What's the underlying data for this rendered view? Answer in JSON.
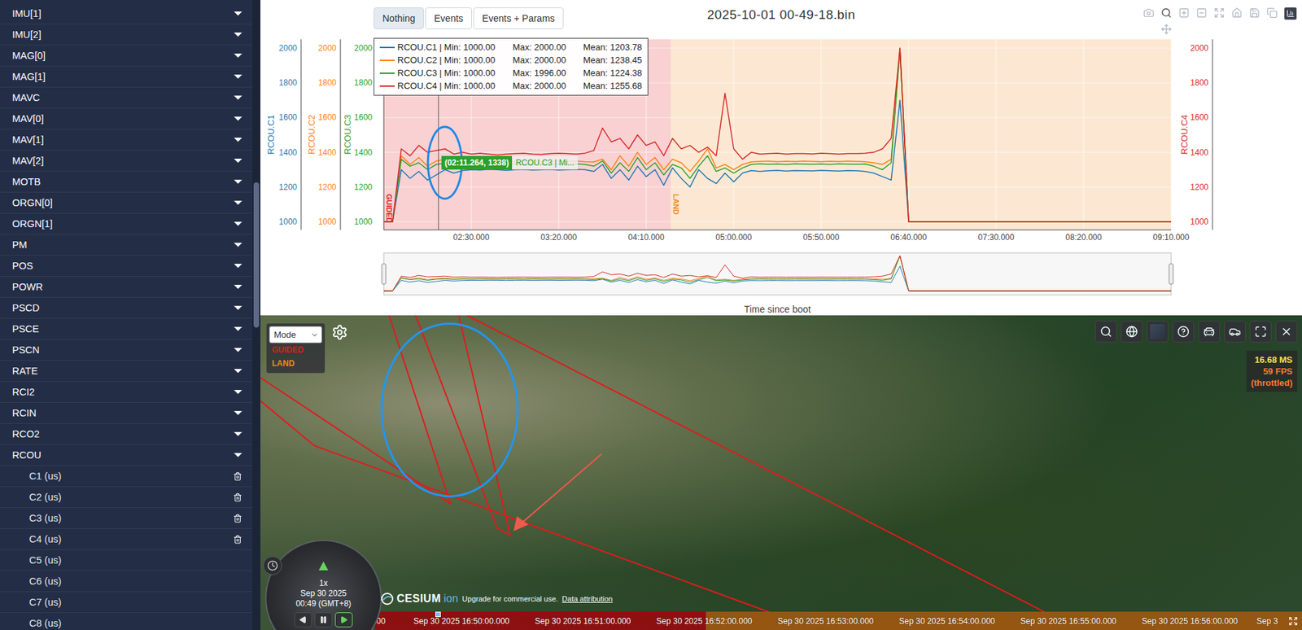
{
  "sidebar": {
    "scroll_position": 0.29,
    "scroll_size": 0.23,
    "items": [
      {
        "label": "IMU[1]",
        "expanded": false
      },
      {
        "label": "IMU[2]",
        "expanded": false
      },
      {
        "label": "MAG[0]",
        "expanded": false
      },
      {
        "label": "MAG[1]",
        "expanded": false
      },
      {
        "label": "MAVC",
        "expanded": false
      },
      {
        "label": "MAV[0]",
        "expanded": false
      },
      {
        "label": "MAV[1]",
        "expanded": false
      },
      {
        "label": "MAV[2]",
        "expanded": false
      },
      {
        "label": "MOTB",
        "expanded": false
      },
      {
        "label": "ORGN[0]",
        "expanded": false
      },
      {
        "label": "ORGN[1]",
        "expanded": false
      },
      {
        "label": "PM",
        "expanded": false
      },
      {
        "label": "POS",
        "expanded": false
      },
      {
        "label": "POWR",
        "expanded": false
      },
      {
        "label": "PSCD",
        "expanded": false
      },
      {
        "label": "PSCE",
        "expanded": false
      },
      {
        "label": "PSCN",
        "expanded": false
      },
      {
        "label": "RATE",
        "expanded": false
      },
      {
        "label": "RCI2",
        "expanded": false
      },
      {
        "label": "RCIN",
        "expanded": false
      },
      {
        "label": "RCO2",
        "expanded": false
      },
      {
        "label": "RCOU",
        "expanded": true,
        "children": [
          {
            "label": "C1 (us)",
            "plotted": true
          },
          {
            "label": "C2 (us)",
            "plotted": true
          },
          {
            "label": "C3 (us)",
            "plotted": true
          },
          {
            "label": "C4 (us)",
            "plotted": true
          },
          {
            "label": "C5 (us)",
            "plotted": false
          },
          {
            "label": "C6 (us)",
            "plotted": false
          },
          {
            "label": "C7 (us)",
            "plotted": false
          },
          {
            "label": "C8 (us)",
            "plotted": false
          }
        ]
      }
    ]
  },
  "plot": {
    "filter_buttons": [
      {
        "label": "Nothing",
        "selected": true
      },
      {
        "label": "Events",
        "selected": false
      },
      {
        "label": "Events + Params",
        "selected": false
      }
    ],
    "title": "2025-10-01 00-49-18.bin",
    "modebar": [
      {
        "kind": "camera",
        "selected": false
      },
      {
        "kind": "zoom",
        "selected": true
      },
      {
        "kind": "zoom-in",
        "selected": false
      },
      {
        "kind": "zoom-out",
        "selected": false
      },
      {
        "kind": "autoscale",
        "selected": false
      },
      {
        "kind": "home",
        "selected": false
      },
      {
        "kind": "save",
        "selected": false
      },
      {
        "kind": "copy",
        "selected": false
      },
      {
        "kind": "logo",
        "selected": false
      },
      {
        "kind": "pan",
        "selected": false
      }
    ],
    "x_axis": {
      "title": "Time since boot",
      "min_s": 100,
      "max_s": 550,
      "ticks": [
        {
          "label": "02:30.000",
          "t_s": 150
        },
        {
          "label": "03:20.000",
          "t_s": 200
        },
        {
          "label": "04:10.000",
          "t_s": 250
        },
        {
          "label": "05:00.000",
          "t_s": 300
        },
        {
          "label": "05:50.000",
          "t_s": 350
        },
        {
          "label": "06:40.000",
          "t_s": 400
        },
        {
          "label": "07:30.000",
          "t_s": 450
        },
        {
          "label": "08:20.000",
          "t_s": 500
        },
        {
          "label": "09:10.000",
          "t_s": 550
        }
      ]
    },
    "y_ticks": [
      "1000",
      "1200",
      "1400",
      "1600",
      "1800",
      "2000"
    ],
    "sample_start_s": 100,
    "sample_step_s": 5,
    "series": [
      {
        "name": "RCOU.C1",
        "color": "#1f77b4",
        "side": "left",
        "legend": "RCOU.C1 | Min: 1000.00",
        "max": "Max: 2000.00",
        "mean": "Mean: 1203.78",
        "values": [
          1000,
          1000,
          1300,
          1250,
          1290,
          1240,
          1270,
          1300,
          1280,
          1295,
          1300,
          1298,
          1302,
          1300,
          1296,
          1300,
          1302,
          1298,
          1300,
          1302,
          1298,
          1300,
          1302,
          1300,
          1290,
          1330,
          1250,
          1300,
          1240,
          1320,
          1260,
          1300,
          1210,
          1310,
          1250,
          1200,
          1300,
          1250,
          1220,
          1280,
          1230,
          1280,
          1295,
          1290,
          1294,
          1296,
          1292,
          1295,
          1294,
          1293,
          1296,
          1294,
          1292,
          1295,
          1294,
          1290,
          1280,
          1260,
          1240,
          1700,
          1000,
          1000,
          1000,
          1000,
          1000,
          1000,
          1000,
          1000,
          1000,
          1000,
          1000,
          1000,
          1000,
          1000,
          1000,
          1000,
          1000,
          1000,
          1000,
          1000,
          1000,
          1000,
          1000,
          1000,
          1000,
          1000,
          1000,
          1000,
          1000,
          1000,
          1000
        ]
      },
      {
        "name": "RCOU.C2",
        "color": "#ff7f0e",
        "side": "left",
        "legend": "RCOU.C2 | Min: 1000.00",
        "max": "Max: 2000.00",
        "mean": "Mean: 1238.45",
        "values": [
          1000,
          1000,
          1380,
          1330,
          1370,
          1320,
          1350,
          1360,
          1340,
          1350,
          1345,
          1348,
          1350,
          1346,
          1348,
          1350,
          1347,
          1350,
          1348,
          1346,
          1350,
          1348,
          1350,
          1346,
          1345,
          1360,
          1300,
          1380,
          1320,
          1400,
          1330,
          1370,
          1300,
          1360,
          1340,
          1290,
          1350,
          1420,
          1310,
          1330,
          1300,
          1330,
          1345,
          1348,
          1350,
          1346,
          1349,
          1347,
          1350,
          1348,
          1346,
          1349,
          1347,
          1350,
          1348,
          1346,
          1340,
          1330,
          1360,
          2000,
          1000,
          1000,
          1000,
          1000,
          1000,
          1000,
          1000,
          1000,
          1000,
          1000,
          1000,
          1000,
          1000,
          1000,
          1000,
          1000,
          1000,
          1000,
          1000,
          1000,
          1000,
          1000,
          1000,
          1000,
          1000,
          1000,
          1000,
          1000,
          1000,
          1000,
          1000
        ]
      },
      {
        "name": "RCOU.C3",
        "color": "#2ca02c",
        "side": "left",
        "legend": "RCOU.C3 | Min: 1000.00",
        "max": "Max: 1996.00",
        "mean": "Mean: 1224.38",
        "values": [
          1000,
          1000,
          1360,
          1320,
          1340,
          1300,
          1330,
          1338,
          1325,
          1335,
          1330,
          1334,
          1332,
          1330,
          1335,
          1333,
          1331,
          1334,
          1332,
          1330,
          1333,
          1331,
          1334,
          1330,
          1320,
          1350,
          1280,
          1340,
          1290,
          1370,
          1300,
          1340,
          1270,
          1330,
          1310,
          1250,
          1320,
          1380,
          1290,
          1310,
          1280,
          1310,
          1330,
          1334,
          1331,
          1333,
          1330,
          1334,
          1332,
          1331,
          1333,
          1330,
          1334,
          1332,
          1331,
          1333,
          1320,
          1300,
          1340,
          1996,
          1000,
          1000,
          1000,
          1000,
          1000,
          1000,
          1000,
          1000,
          1000,
          1000,
          1000,
          1000,
          1000,
          1000,
          1000,
          1000,
          1000,
          1000,
          1000,
          1000,
          1000,
          1000,
          1000,
          1000,
          1000,
          1000,
          1000,
          1000,
          1000,
          1000,
          1000
        ]
      },
      {
        "name": "RCOU.C4",
        "color": "#d62728",
        "side": "right",
        "legend": "RCOU.C4 | Min: 1000.00",
        "max": "Max: 2000.00",
        "mean": "Mean: 1255.68",
        "values": [
          1000,
          1000,
          1420,
          1380,
          1440,
          1400,
          1410,
          1420,
          1390,
          1400,
          1390,
          1395,
          1390,
          1385,
          1390,
          1392,
          1395,
          1390,
          1388,
          1392,
          1395,
          1392,
          1390,
          1395,
          1410,
          1540,
          1460,
          1480,
          1420,
          1500,
          1440,
          1460,
          1380,
          1480,
          1420,
          1440,
          1400,
          1430,
          1380,
          1740,
          1420,
          1360,
          1400,
          1390,
          1392,
          1394,
          1390,
          1393,
          1392,
          1391,
          1394,
          1392,
          1390,
          1393,
          1392,
          1394,
          1400,
          1420,
          1480,
          2000,
          1000,
          1000,
          1000,
          1000,
          1000,
          1000,
          1000,
          1000,
          1000,
          1000,
          1000,
          1000,
          1000,
          1000,
          1000,
          1000,
          1000,
          1000,
          1000,
          1000,
          1000,
          1000,
          1000,
          1000,
          1000,
          1000,
          1000,
          1000,
          1000,
          1000,
          1000
        ]
      }
    ],
    "modes": [
      {
        "name": "GUIDED",
        "start_s": 100,
        "color": "#e31a1c"
      },
      {
        "name": "LAND",
        "start_s": 264,
        "color": "#f08a1c"
      }
    ],
    "hover": {
      "t_s": 131.264,
      "value": 1338,
      "label": "(02:11.264, 1338)",
      "series": "RCOU.C3 | Mi...",
      "color": "#2ca02c"
    }
  },
  "map": {
    "mode_select": {
      "placeholder": "Mode"
    },
    "toolbar": [
      {
        "kind": "search"
      },
      {
        "kind": "globe"
      },
      {
        "kind": "layer"
      },
      {
        "kind": "help"
      },
      {
        "kind": "vehicle"
      },
      {
        "kind": "car"
      },
      {
        "kind": "fullscreen"
      },
      {
        "kind": "close"
      }
    ],
    "performance": {
      "ms": "16.68 MS",
      "fps": "59 FPS",
      "note": "(throttled)"
    },
    "clock": {
      "speed": "1x",
      "date": "Sep 30 2025",
      "time": "00:49 (GMT+8)",
      "controls": [
        {
          "kind": "reverse",
          "selected": false
        },
        {
          "kind": "pause",
          "selected": false
        },
        {
          "kind": "play",
          "selected": true
        }
      ]
    },
    "credits": {
      "logo": "CESIUM",
      "logo_suffix": "ion",
      "upgrade": "Upgrade for commercial use.",
      "attribution": "Data attribution"
    },
    "timeline": {
      "start_s": 100,
      "playhead_s": 131.264,
      "labels": [
        "00",
        "Sep 30 2025 16:50:00.000",
        "Sep 30 2025 16:51:00.000",
        "Sep 30 2025 16:52:00.000",
        "Sep 30 2025 16:53:00.000",
        "Sep 30 2025 16:54:00.000",
        "Sep 30 2025 16:55:00.000",
        "Sep 30 2025 16:56:00.000",
        "Sep 3"
      ]
    }
  }
}
